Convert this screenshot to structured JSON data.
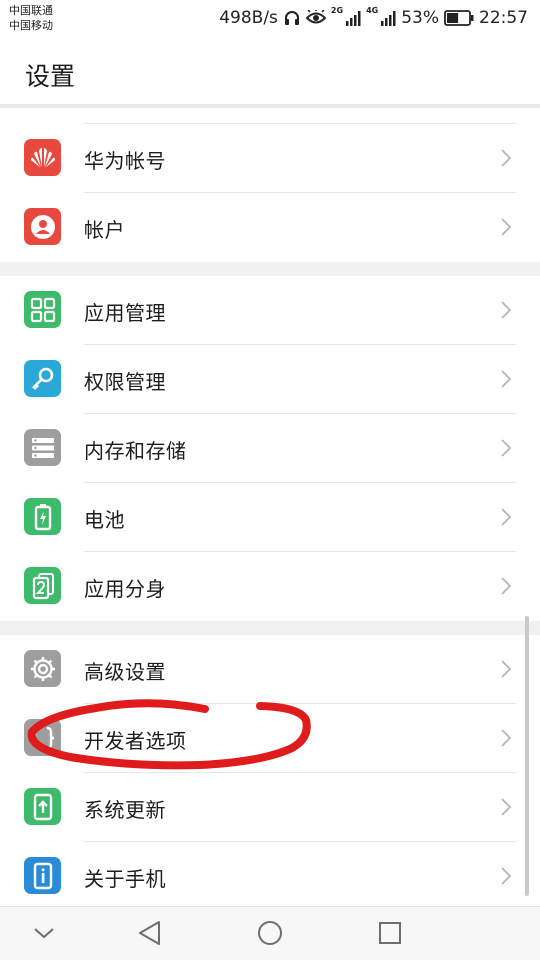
{
  "status_bar": {
    "carrier_1": "中国联通",
    "carrier_2": "中国移动",
    "network_speed": "498B/s",
    "signal_1_label": "2G",
    "signal_2_label": "4G",
    "battery_percent": "53%",
    "battery_level": 0.53,
    "time": "22:57"
  },
  "header": {
    "title": "设置"
  },
  "groups": [
    {
      "items": [
        {
          "label": "华为帐号",
          "icon": "huawei-logo-icon",
          "color": "#e8493f"
        },
        {
          "label": "帐户",
          "icon": "account-person-icon",
          "color": "#e8493f"
        }
      ]
    },
    {
      "items": [
        {
          "label": "应用管理",
          "icon": "app-grid-icon",
          "color": "#3dbb6b"
        },
        {
          "label": "权限管理",
          "icon": "key-icon",
          "color": "#2aa8d8"
        },
        {
          "label": "内存和存储",
          "icon": "storage-icon",
          "color": "#9e9e9e"
        },
        {
          "label": "电池",
          "icon": "battery-icon",
          "color": "#3dbb6b"
        },
        {
          "label": "应用分身",
          "icon": "app-twin-icon",
          "color": "#3dbb6b"
        }
      ]
    },
    {
      "items": [
        {
          "label": "高级设置",
          "icon": "gear-icon",
          "color": "#9e9e9e"
        },
        {
          "label": "开发者选项",
          "icon": "developer-braces-icon",
          "color": "#9e9e9e"
        },
        {
          "label": "系统更新",
          "icon": "system-update-icon",
          "color": "#3dbb6b"
        },
        {
          "label": "关于手机",
          "icon": "about-phone-icon",
          "color": "#2a8bd8"
        }
      ]
    }
  ],
  "nav_bar": {
    "buttons": [
      "chevron-down-icon",
      "back-triangle-icon",
      "home-circle-icon",
      "recents-square-icon"
    ]
  },
  "annotation": {
    "color": "#e01b1b"
  }
}
